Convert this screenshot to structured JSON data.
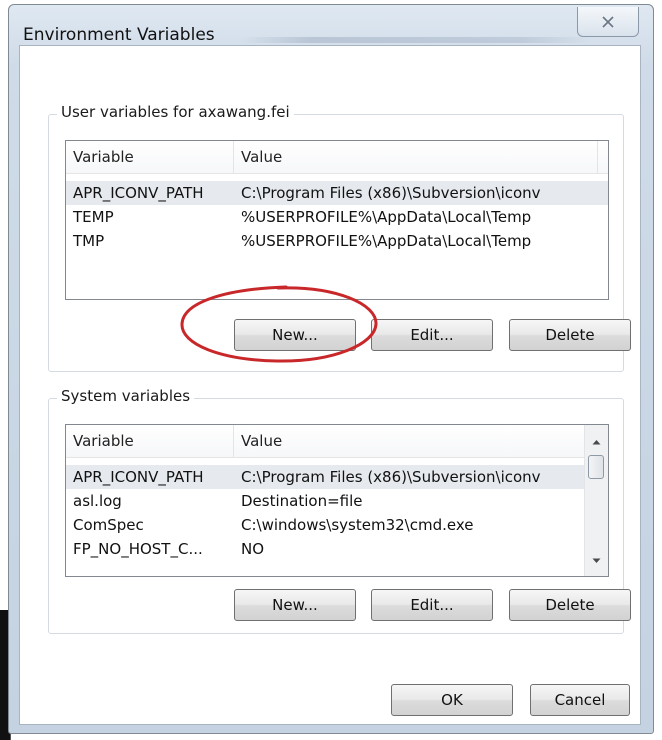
{
  "dialog": {
    "title": "Environment Variables",
    "close_glyph": "✕"
  },
  "user_vars": {
    "group_label": "User variables for axawang.fei",
    "columns": [
      "Variable",
      "Value"
    ],
    "rows": [
      {
        "variable": "APR_ICONV_PATH",
        "value": "C:\\Program Files (x86)\\Subversion\\iconv",
        "selected": true
      },
      {
        "variable": "TEMP",
        "value": "%USERPROFILE%\\AppData\\Local\\Temp",
        "selected": false
      },
      {
        "variable": "TMP",
        "value": "%USERPROFILE%\\AppData\\Local\\Temp",
        "selected": false
      }
    ],
    "buttons": {
      "new": "New...",
      "edit": "Edit...",
      "delete": "Delete"
    }
  },
  "system_vars": {
    "group_label": "System variables",
    "columns": [
      "Variable",
      "Value"
    ],
    "rows": [
      {
        "variable": "APR_ICONV_PATH",
        "value": "C:\\Program Files (x86)\\Subversion\\iconv",
        "selected": true
      },
      {
        "variable": "asl.log",
        "value": "Destination=file",
        "selected": false
      },
      {
        "variable": "ComSpec",
        "value": "C:\\windows\\system32\\cmd.exe",
        "selected": false
      },
      {
        "variable": "FP_NO_HOST_C...",
        "value": "NO",
        "selected": false
      }
    ],
    "buttons": {
      "new": "New...",
      "edit": "Edit...",
      "delete": "Delete"
    }
  },
  "footer": {
    "ok": "OK",
    "cancel": "Cancel"
  },
  "annotation": {
    "color": "#c8282a"
  },
  "icons": {
    "close": "close-icon",
    "scroll_up": "scroll-up-arrow-icon",
    "scroll_down": "scroll-down-arrow-icon"
  }
}
